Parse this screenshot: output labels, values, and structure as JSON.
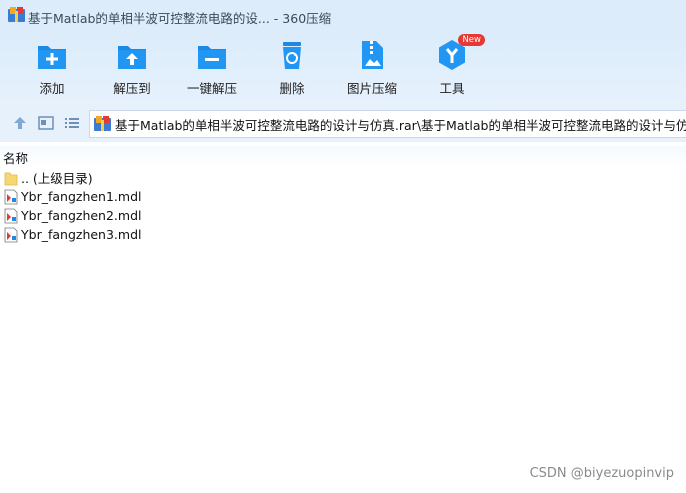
{
  "window": {
    "title": "基于Matlab的单相半波可控整流电路的设... - 360压缩"
  },
  "toolbar": {
    "items": [
      {
        "label": "添加",
        "icon": "add-folder-icon"
      },
      {
        "label": "解压到",
        "icon": "extract-to-icon"
      },
      {
        "label": "一键解压",
        "icon": "one-click-extract-icon"
      },
      {
        "label": "删除",
        "icon": "recycle-bin-icon"
      },
      {
        "label": "图片压缩",
        "icon": "image-compress-icon"
      },
      {
        "label": "工具",
        "icon": "tools-icon",
        "badge": "New"
      }
    ]
  },
  "navigation": {
    "address": "基于Matlab的单相半波可控整流电路的设计与仿真.rar\\基于Matlab的单相半波可控整流电路的设计与仿真"
  },
  "file_list": {
    "column_name": "名称",
    "rows": [
      {
        "name": ".. (上级目录)",
        "icon": "parent-folder-icon"
      },
      {
        "name": "Ybr_fangzhen1.mdl",
        "icon": "mdl-file-icon"
      },
      {
        "name": "Ybr_fangzhen2.mdl",
        "icon": "mdl-file-icon"
      },
      {
        "name": "Ybr_fangzhen3.mdl",
        "icon": "mdl-file-icon"
      }
    ]
  },
  "watermark": "CSDN @biyezuopinvip",
  "colors": {
    "titlebar_bg": "#dcecfb",
    "accent_blue": "#1e88e5",
    "badge_red": "#e53935"
  }
}
